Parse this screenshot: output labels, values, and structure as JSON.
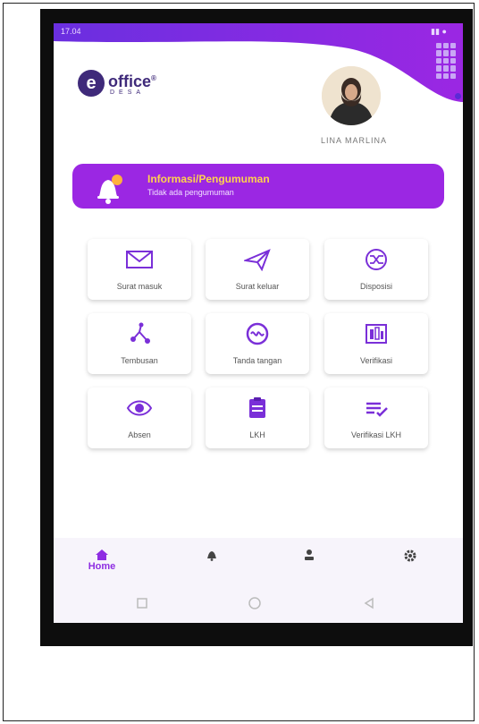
{
  "status_bar": {
    "time": "17.04",
    "right": ""
  },
  "logo": {
    "letter": "e",
    "name": "office",
    "mark": "®",
    "sub": "DESA"
  },
  "user": {
    "name": "LINA MARLINA"
  },
  "announcement": {
    "title": "Informasi/Pengumuman",
    "subtitle": "Tidak ada pengumuman"
  },
  "menu": [
    {
      "label": "Surat masuk",
      "icon": "envelope-icon"
    },
    {
      "label": "Surat keluar",
      "icon": "paper-plane-icon"
    },
    {
      "label": "Disposisi",
      "icon": "shuffle-icon"
    },
    {
      "label": "Tembusan",
      "icon": "share-nodes-icon"
    },
    {
      "label": "Tanda tangan",
      "icon": "signature-icon"
    },
    {
      "label": "Verifikasi",
      "icon": "verify-icon"
    },
    {
      "label": "Absen",
      "icon": "eye-icon"
    },
    {
      "label": "LKH",
      "icon": "clipboard-icon"
    },
    {
      "label": "Verifikasi LKH",
      "icon": "list-check-icon"
    }
  ],
  "bottom_nav": {
    "home_label": "Home",
    "items": [
      "home-icon",
      "bell-icon",
      "profile-icon",
      "settings-icon"
    ]
  },
  "colors": {
    "primary": "#9b27e3",
    "deep": "#5a2bd6",
    "accent": "#ffd24d",
    "icon": "#7a2fd8"
  }
}
